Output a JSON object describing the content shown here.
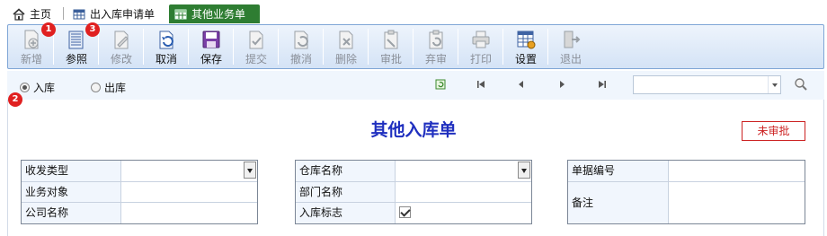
{
  "tabs": [
    {
      "label": "主页",
      "icon": "home-icon",
      "active": false
    },
    {
      "label": "出入库申请单",
      "icon": "table-icon",
      "active": false
    },
    {
      "label": "其他业务单",
      "icon": "table-icon",
      "active": true
    }
  ],
  "toolbar": {
    "buttons": [
      {
        "label": "新增",
        "icon": "add-document-icon",
        "enabled": false
      },
      {
        "label": "参照",
        "icon": "reference-icon",
        "enabled": true
      },
      {
        "label": "修改",
        "icon": "edit-icon",
        "enabled": false
      },
      {
        "label": "取消",
        "icon": "undo-icon",
        "enabled": true
      },
      {
        "label": "保存",
        "icon": "save-icon",
        "enabled": true
      },
      {
        "label": "提交",
        "icon": "submit-icon",
        "enabled": false
      },
      {
        "label": "撤消",
        "icon": "revoke-icon",
        "enabled": false
      },
      {
        "label": "删除",
        "icon": "delete-icon",
        "enabled": false
      },
      {
        "label": "审批",
        "icon": "approve-icon",
        "enabled": false
      },
      {
        "label": "弃审",
        "icon": "unapprove-icon",
        "enabled": false
      },
      {
        "label": "打印",
        "icon": "print-icon",
        "enabled": false
      },
      {
        "label": "设置",
        "icon": "settings-icon",
        "enabled": true
      },
      {
        "label": "退出",
        "icon": "exit-icon",
        "enabled": false
      }
    ]
  },
  "badges": [
    "1",
    "2",
    "3"
  ],
  "direction": {
    "options": [
      {
        "label": "入库",
        "selected": true
      },
      {
        "label": "出库",
        "selected": false
      }
    ]
  },
  "search": {
    "value": ""
  },
  "form": {
    "title": "其他入库单",
    "status": "未审批",
    "left": [
      {
        "label": "收发类型",
        "value": ""
      },
      {
        "label": "业务对象",
        "value": ""
      },
      {
        "label": "公司名称",
        "value": ""
      }
    ],
    "middle": [
      {
        "label": "仓库名称",
        "value": ""
      },
      {
        "label": "部门名称",
        "value": ""
      },
      {
        "label": "入库标志",
        "checked": true
      }
    ],
    "right": [
      {
        "label": "单据编号",
        "value": ""
      },
      {
        "label": "备注",
        "value": ""
      }
    ]
  },
  "colors": {
    "active_tab": "#2e7d32",
    "title": "#1f2fbf",
    "status": "#cc2222",
    "badge": "#e02020"
  }
}
